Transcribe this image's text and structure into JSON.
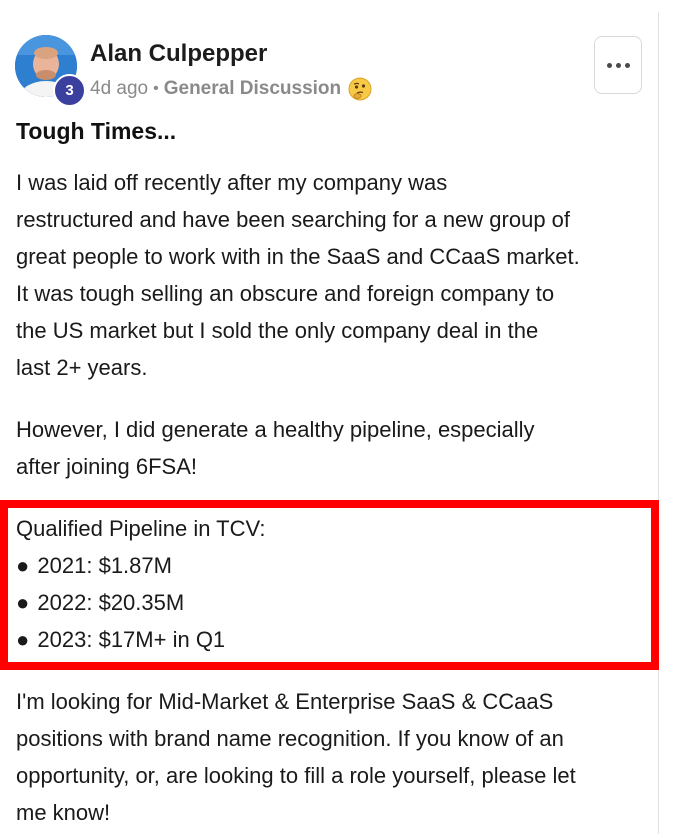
{
  "post": {
    "author": {
      "name": "Alan Culpepper",
      "level": "3"
    },
    "meta": {
      "time": "4d ago",
      "separator": "•",
      "category": "General Discussion",
      "emoji": "thinking-face-icon"
    },
    "title": "Tough Times...",
    "paragraph1": [
      "I was laid off recently after my company was",
      "restructured and have been searching for a new group of",
      "great people to work with in the SaaS and CCaaS market.",
      "It was tough selling an obscure and foreign company to",
      "the US market but I sold the only company deal in the",
      "last 2+ years."
    ],
    "paragraph2": [
      "However, I did generate a healthy pipeline, especially",
      "after joining 6FSA!"
    ],
    "pipeline": {
      "heading": "Qualified Pipeline in TCV:",
      "bullet": "●",
      "items": [
        "2021: $1.87M",
        "2022: $20.35M",
        "2023: $17M+ in Q1"
      ]
    },
    "paragraph3": [
      "I'm looking for Mid-Market & Enterprise SaaS & CCaaS",
      "positions with brand name recognition. If you know of an",
      "opportunity, or, are looking to fill a role yourself, please let",
      "me know!"
    ],
    "colors": {
      "highlight": "#ff0000",
      "badge": "#3b3f9e",
      "meta_text": "#8a8a8a"
    }
  }
}
